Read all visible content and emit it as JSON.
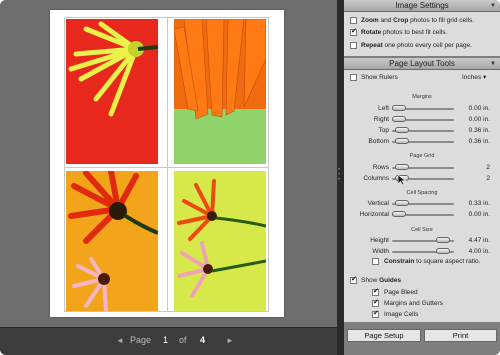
{
  "pagebar": {
    "prev": "◄",
    "page_label": "Page",
    "current_page": "1",
    "of_label": "of",
    "total_pages": "4",
    "next": "►"
  },
  "image_settings": {
    "title": "Image Settings",
    "options": [
      {
        "bold": "Zoom",
        "mid": " and ",
        "bold2": "Crop",
        "rest": " photos to fill grid cells.",
        "checked": false
      },
      {
        "bold": "Rotate",
        "mid": "",
        "bold2": "",
        "rest": " photos to best fit cells.",
        "checked": true
      },
      {
        "bold": "Repeat",
        "mid": "",
        "bold2": "",
        "rest": " one photo every cell per page.",
        "checked": false
      }
    ]
  },
  "layout_tools": {
    "title": "Page Layout Tools",
    "show_rulers": "Show Rulers",
    "show_rulers_checked": false,
    "units": "Inches",
    "margins": {
      "heading": "Margins",
      "rows": [
        {
          "name": "Left",
          "value": "0.00 in.",
          "level": 0
        },
        {
          "name": "Right",
          "value": "0.00 in.",
          "level": 0
        },
        {
          "name": "Top",
          "value": "0.36 in.",
          "level": 0.07
        },
        {
          "name": "Bottom",
          "value": "0.36 in.",
          "level": 0.07
        }
      ]
    },
    "page_grid": {
      "heading": "Page Grid",
      "rows": [
        {
          "name": "Rows",
          "value": "2",
          "level": 0.07
        },
        {
          "name": "Columns",
          "value": "2",
          "level": 0.07
        }
      ]
    },
    "cell_spacing": {
      "heading": "Cell Spacing",
      "rows": [
        {
          "name": "Vertical",
          "value": "0.33 in.",
          "level": 0.07
        },
        {
          "name": "Horizontal",
          "value": "0.00 in.",
          "level": 0
        }
      ]
    },
    "cell_size": {
      "heading": "Cell Size",
      "rows": [
        {
          "name": "Height",
          "value": "4.47 in.",
          "level": 0.92
        },
        {
          "name": "Width",
          "value": "4.00 in.",
          "level": 0.92
        }
      ]
    },
    "constrain": {
      "bold": "Constrain",
      "rest": " to square aspect ratio.",
      "checked": false
    },
    "show_guides": {
      "bold": "Guides",
      "prefix": "Show ",
      "checked": true
    },
    "guides": [
      {
        "label": "Page Bleed",
        "checked": true
      },
      {
        "label": "Margins and Gutters",
        "checked": true
      },
      {
        "label": "Image Cells",
        "checked": true
      }
    ]
  },
  "buttons": {
    "page_setup": "Page Setup",
    "print": "Print"
  },
  "colors": {
    "panel_bg": "#dcdcdc",
    "canvas_bg": "#6e6e6e",
    "photo1_bg": "#e8281c",
    "photo2_bg": "#8fd36a",
    "photo3_bg": "#f2a51a",
    "photo4_bg": "#d7e84a"
  },
  "photos": [
    {
      "name": "yellow-gerbera-on-red-photo"
    },
    {
      "name": "orange-gerbera-with-droplets-photo"
    },
    {
      "name": "red-gerberas-on-orange-photo"
    },
    {
      "name": "orange-pink-gerberas-on-yellow-green-photo"
    }
  ]
}
